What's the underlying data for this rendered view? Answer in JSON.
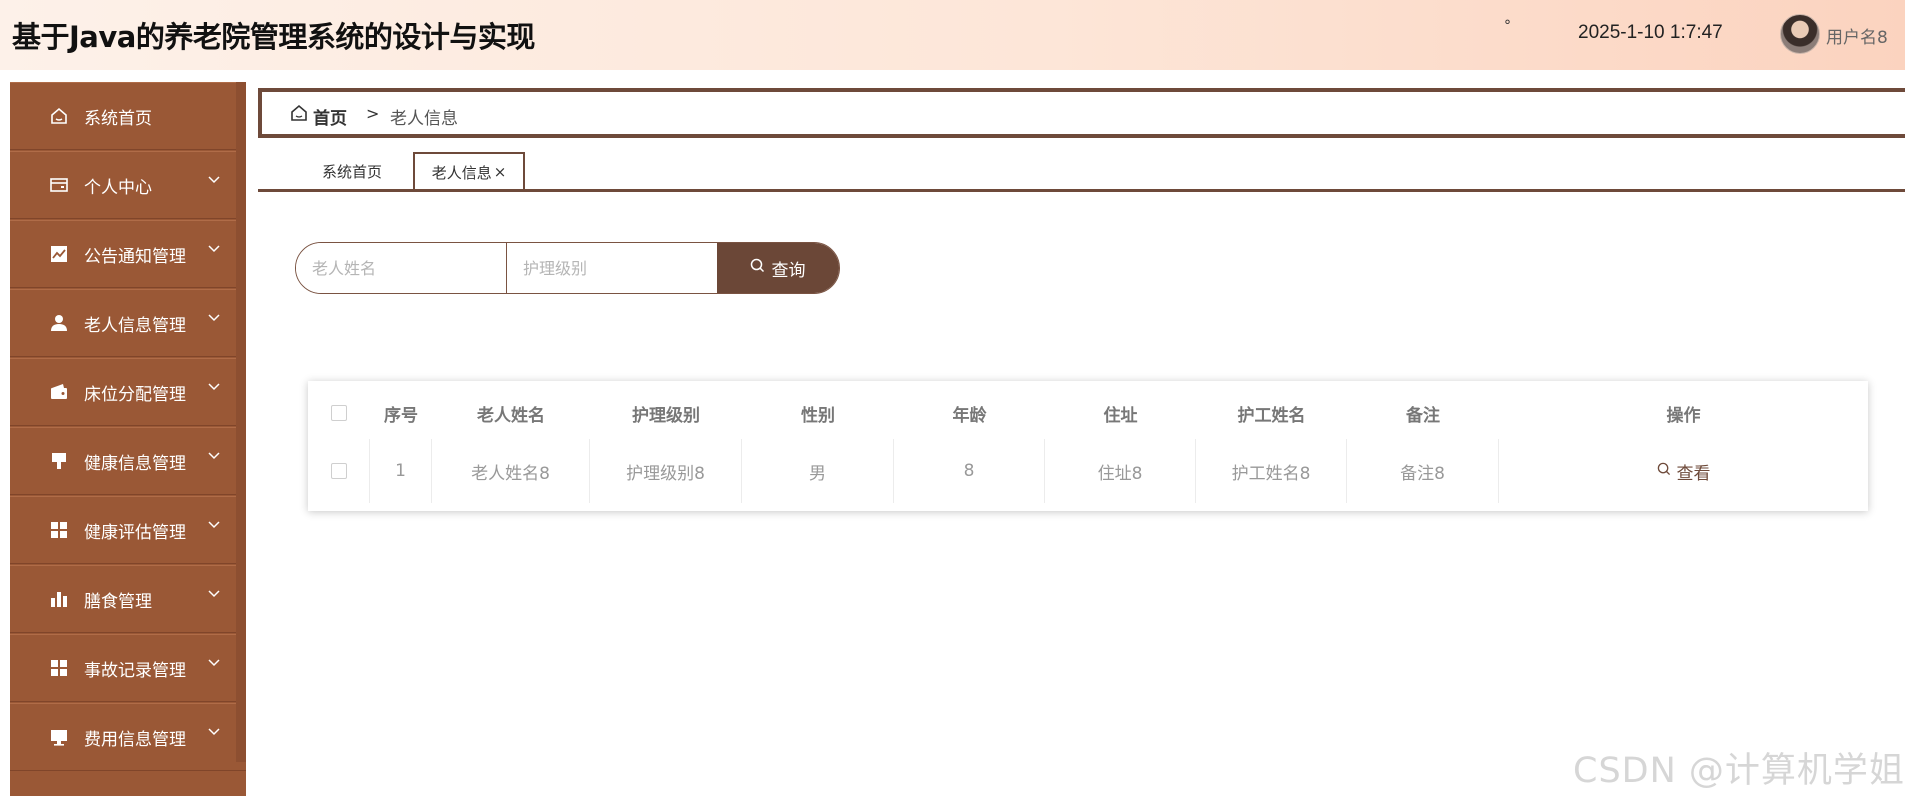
{
  "header": {
    "title": "基于Java的养老院管理系统的设计与实现",
    "dot": "°",
    "datetime": "2025-1-10 1:7:47",
    "username": "用户名8"
  },
  "sidebar": {
    "items": [
      {
        "label": "系统首页",
        "icon": "home-icon",
        "expandable": false
      },
      {
        "label": "个人中心",
        "icon": "wallet-card-icon",
        "expandable": true
      },
      {
        "label": "公告通知管理",
        "icon": "chart-line-icon",
        "expandable": true
      },
      {
        "label": "老人信息管理",
        "icon": "user-icon",
        "expandable": true
      },
      {
        "label": "床位分配管理",
        "icon": "wallet-icon",
        "expandable": true
      },
      {
        "label": "健康信息管理",
        "icon": "brush-icon",
        "expandable": true
      },
      {
        "label": "健康评估管理",
        "icon": "grid-icon",
        "expandable": true
      },
      {
        "label": "膳食管理",
        "icon": "bar-chart-icon",
        "expandable": true
      },
      {
        "label": "事故记录管理",
        "icon": "grid-icon",
        "expandable": true
      },
      {
        "label": "费用信息管理",
        "icon": "monitor-icon",
        "expandable": true
      }
    ]
  },
  "breadcrumb": {
    "home": "首页",
    "separator": ">",
    "current": "老人信息"
  },
  "tabs": [
    {
      "label": "系统首页"
    },
    {
      "label": "老人信息",
      "close": "×"
    }
  ],
  "search": {
    "name_placeholder": "老人姓名",
    "level_placeholder": "护理级别",
    "button_label": "查询"
  },
  "table": {
    "columns": [
      "序号",
      "老人姓名",
      "护理级别",
      "性别",
      "年龄",
      "住址",
      "护工姓名",
      "备注",
      "操作"
    ],
    "rows": [
      {
        "index": "1",
        "name": "老人姓名8",
        "care_level": "护理级别8",
        "gender": "男",
        "age": "8",
        "address": "住址8",
        "caregiver": "护工姓名8",
        "remark": "备注8",
        "action": "查看"
      }
    ]
  },
  "watermark": "CSDN @计算机学姐",
  "colors": {
    "sidebar": "#9a5836",
    "accent": "#6b4737",
    "header_gradient_start": "#fdf1e9",
    "header_gradient_end": "#fbd3bf"
  }
}
